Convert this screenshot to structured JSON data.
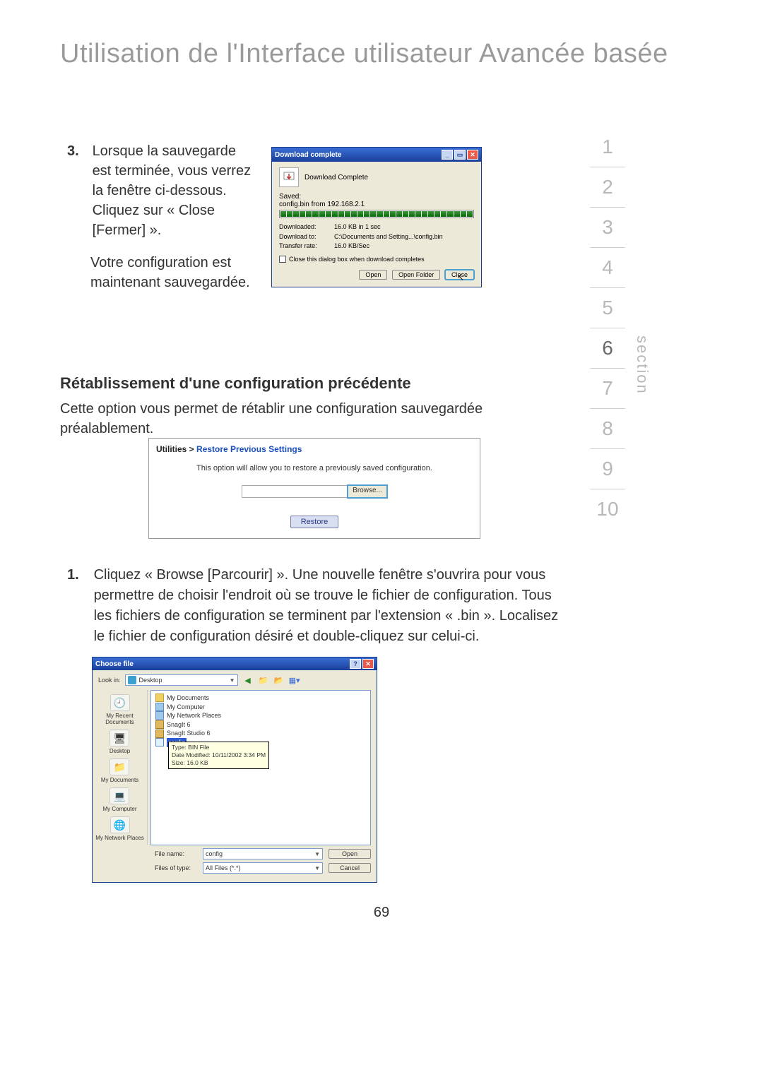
{
  "page_title": "Utilisation de l'Interface utilisateur Avancée basée",
  "section_label": "section",
  "section_nav": {
    "items": [
      "1",
      "2",
      "3",
      "4",
      "5",
      "6",
      "7",
      "8",
      "9",
      "10"
    ],
    "active_index": 5
  },
  "page_number": "69",
  "step3": {
    "number": "3.",
    "para1": "Lorsque la sauvegarde est terminée, vous verrez la fenêtre ci-dessous.",
    "para2": "Cliquez sur « Close [Fermer] ».",
    "para3": "Votre configuration est maintenant sauvegardée."
  },
  "download_dialog": {
    "title": "Download complete",
    "heading": "Download Complete",
    "saved_label": "Saved:",
    "saved_value": "config.bin from 192.168.2.1",
    "info": {
      "downloaded_label": "Downloaded:",
      "downloaded_value": "16.0 KB in 1 sec",
      "downloadto_label": "Download to:",
      "downloadto_value": "C:\\Documents and Setting...\\config.bin",
      "rate_label": "Transfer rate:",
      "rate_value": "16.0 KB/Sec"
    },
    "close_checkbox": "Close this dialog box when download completes",
    "buttons": {
      "open": "Open",
      "open_folder": "Open Folder",
      "close": "Close"
    }
  },
  "restore_section": {
    "heading": "Rétablissement d'une configuration précédente",
    "paragraph": "Cette option vous permet de rétablir une configuration sauvegardée préalablement."
  },
  "restore_panel": {
    "breadcrumb_seg0": "Utilities > ",
    "breadcrumb_seg1": "Restore Previous Settings",
    "description": "This option will allow you to restore a previously saved configuration.",
    "browse_label": "Browse...",
    "restore_btn": "Restore"
  },
  "step1": {
    "number": "1.",
    "text": "Cliquez « Browse [Parcourir] ». Une nouvelle fenêtre s'ouvrira pour vous permettre de choisir l'endroit où se trouve le fichier de configuration. Tous les fichiers de configuration se terminent par l'extension « .bin ». Localisez le fichier de configuration désiré et double-cliquez sur celui-ci."
  },
  "choose_dialog": {
    "title": "Choose file",
    "lookin_label": "Look in:",
    "lookin_value": "Desktop",
    "places": {
      "recent": "My Recent Documents",
      "desktop": "Desktop",
      "mydocs": "My Documents",
      "mycomp": "My Computer",
      "mynet": "My Network Places"
    },
    "files": {
      "mydocs": "My Documents",
      "mycomp": "My Computer",
      "mynet": "My Network Places",
      "snagit": "SnagIt 6",
      "snagitstudio": "SnagIt Studio 6",
      "config": "config"
    },
    "tooltip": {
      "type": "Type: BIN File",
      "modified": "Date Modified: 10/11/2002 3:34 PM",
      "size": "Size: 16.0 KB"
    },
    "filename_label": "File name:",
    "filename_value": "config",
    "filetype_label": "Files of type:",
    "filetype_value": "All Files (*.*)",
    "open_btn": "Open",
    "cancel_btn": "Cancel"
  }
}
